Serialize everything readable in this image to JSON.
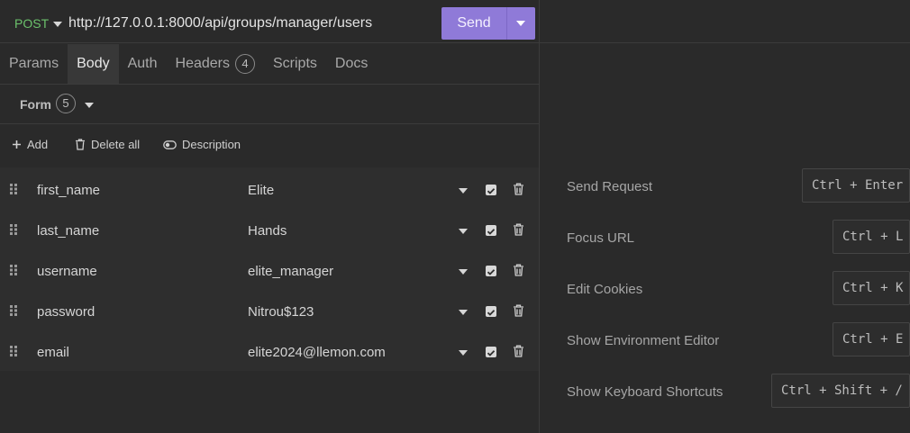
{
  "request": {
    "method": "POST",
    "url": "http://127.0.0.1:8000/api/groups/manager/users",
    "send_label": "Send"
  },
  "tabs": [
    {
      "label": "Params"
    },
    {
      "label": "Body",
      "active": true
    },
    {
      "label": "Auth"
    },
    {
      "label": "Headers",
      "badge": "4"
    },
    {
      "label": "Scripts"
    },
    {
      "label": "Docs"
    }
  ],
  "body": {
    "mode_label": "Form",
    "mode_count": "5",
    "toolbar": {
      "add_label": "Add",
      "delete_all_label": "Delete all",
      "description_label": "Description"
    },
    "params": [
      {
        "name": "first_name",
        "value": "Elite"
      },
      {
        "name": "last_name",
        "value": "Hands"
      },
      {
        "name": "username",
        "value": "elite_manager"
      },
      {
        "name": "password",
        "value": "Nitrou$123"
      },
      {
        "name": "email",
        "value": "elite2024@llemon.com"
      }
    ]
  },
  "shortcuts": [
    {
      "label": "Send Request",
      "keys": "Ctrl + Enter"
    },
    {
      "label": "Focus URL",
      "keys": "Ctrl + L"
    },
    {
      "label": "Edit Cookies",
      "keys": "Ctrl + K"
    },
    {
      "label": "Show Environment Editor",
      "keys": "Ctrl + E"
    },
    {
      "label": "Show Keyboard Shortcuts",
      "keys": "Ctrl + Shift + /"
    }
  ],
  "colors": {
    "method_post": "#6cc26c",
    "send_button": "#8f7ad8",
    "background": "#2a2a2a"
  }
}
